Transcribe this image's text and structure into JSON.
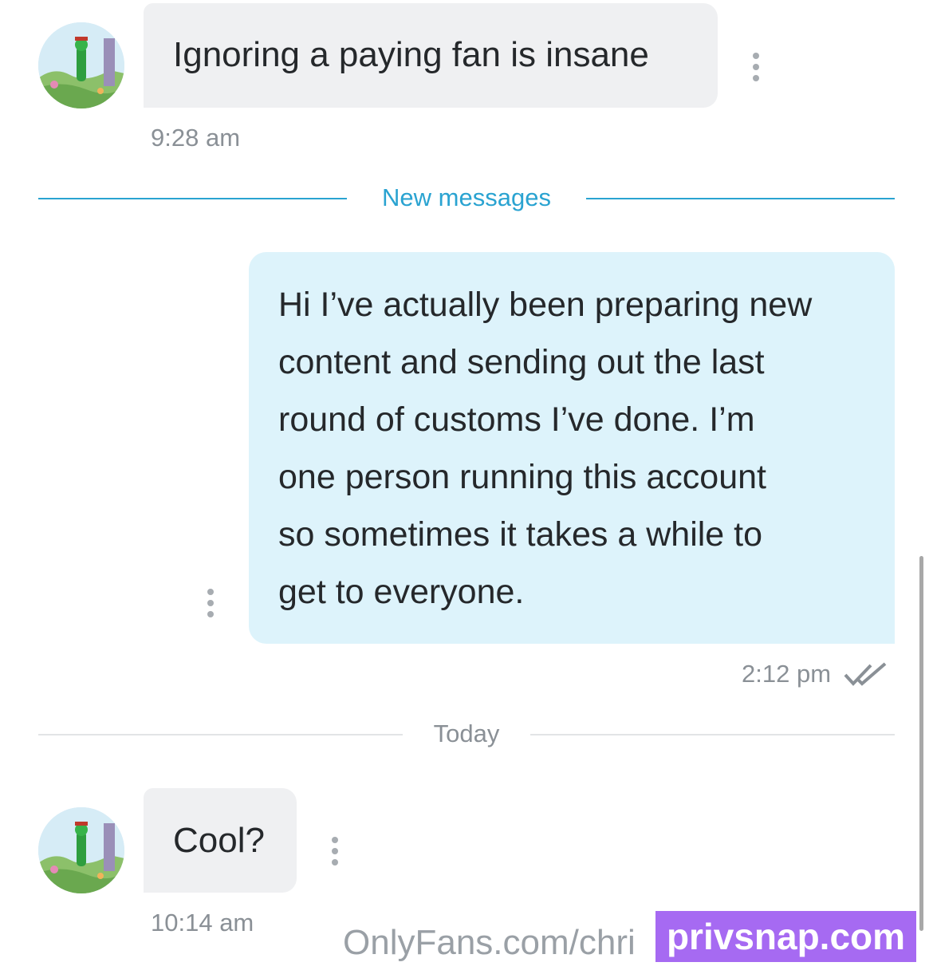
{
  "messages": [
    {
      "direction": "incoming",
      "text": "Ignoring a paying fan is insane",
      "time": "9:28 am"
    },
    {
      "direction": "outgoing",
      "lines": [
        "Hi I’ve actually been preparing new",
        "content and sending out the last",
        "round of customs I’ve done. I’m",
        "one person running this account",
        "so sometimes it takes a while to",
        "get to everyone."
      ],
      "time": "2:12 pm",
      "status_icon": "double-check-icon"
    },
    {
      "direction": "incoming",
      "text": "Cool?",
      "time": "10:14 am"
    }
  ],
  "dividers": {
    "new_messages": "New messages",
    "today": "Today"
  },
  "watermarks": {
    "onlyfans": "OnlyFans.com/chri",
    "privsnap": "privsnap.com"
  },
  "colors": {
    "accent": "#2aa3d1",
    "incoming_bubble": "#eff0f2",
    "outgoing_bubble": "#ddf3fb",
    "timestamp": "#8a9096",
    "watermark_box": "#a66af2"
  }
}
